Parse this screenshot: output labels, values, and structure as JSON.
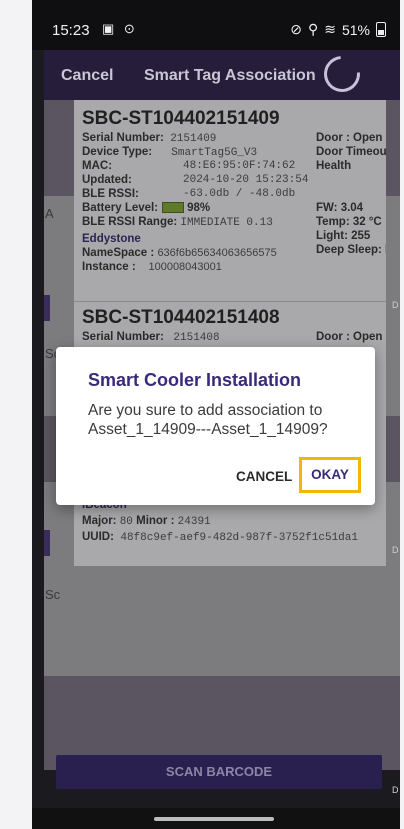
{
  "status": {
    "time": "15:23",
    "battery": "51%"
  },
  "app_bar": {
    "cancel": "Cancel",
    "title": "Smart Tag Association"
  },
  "tags": [
    {
      "title": "SBC-ST104402151409",
      "serial_label": "Serial Number:",
      "serial": "2151409",
      "device_label": "Device Type:",
      "device": "SmartTag5G_V3",
      "mac_label": "MAC:",
      "mac": "48:E6:95:0F:74:62",
      "updated_label": "Updated:",
      "updated": "2024-10-20 15:23:54",
      "rssi_label": "BLE RSSI:",
      "rssi": "-63.0db / -48.0db",
      "battery_label": "Battery Level:",
      "battery": "98%",
      "range_label": "BLE RSSI Range:",
      "range": "IMMEDIATE 0.13",
      "eddystone": "Eddystone",
      "namespace_label": "NameSpace :",
      "namespace": "636f6b65634063656575",
      "instance_label": "Instance :",
      "instance": "100008043001",
      "door": "Door : Open",
      "door_timeout": "Door Timeout",
      "health": "Health",
      "fw": "FW: 3.04",
      "temp": "Temp: 32 °C",
      "light": "Light: 255",
      "deep_sleep": "Deep Sleep: No"
    },
    {
      "title": "SBC-ST104402151408",
      "serial_label": "Serial Number:",
      "serial": "2151408",
      "door": "Door : Open",
      "ibeacon": "IBeacon",
      "major_label": "Major:",
      "major": "80",
      "minor_label": "Minor :",
      "minor": "24391",
      "uuid_label": "UUID:",
      "uuid": "48f8c9ef-aef9-482d-987f-3752f1c51da1"
    }
  ],
  "dialog": {
    "title": "Smart Cooler Installation",
    "message": "Are you sure to add association to Asset_1_14909---Asset_1_14909?",
    "cancel": "CANCEL",
    "okay": "OKAY"
  },
  "scan_button": "SCAN BARCODE",
  "colors": {
    "highlight": "#f2b705",
    "brand": "#3a2a7a"
  }
}
